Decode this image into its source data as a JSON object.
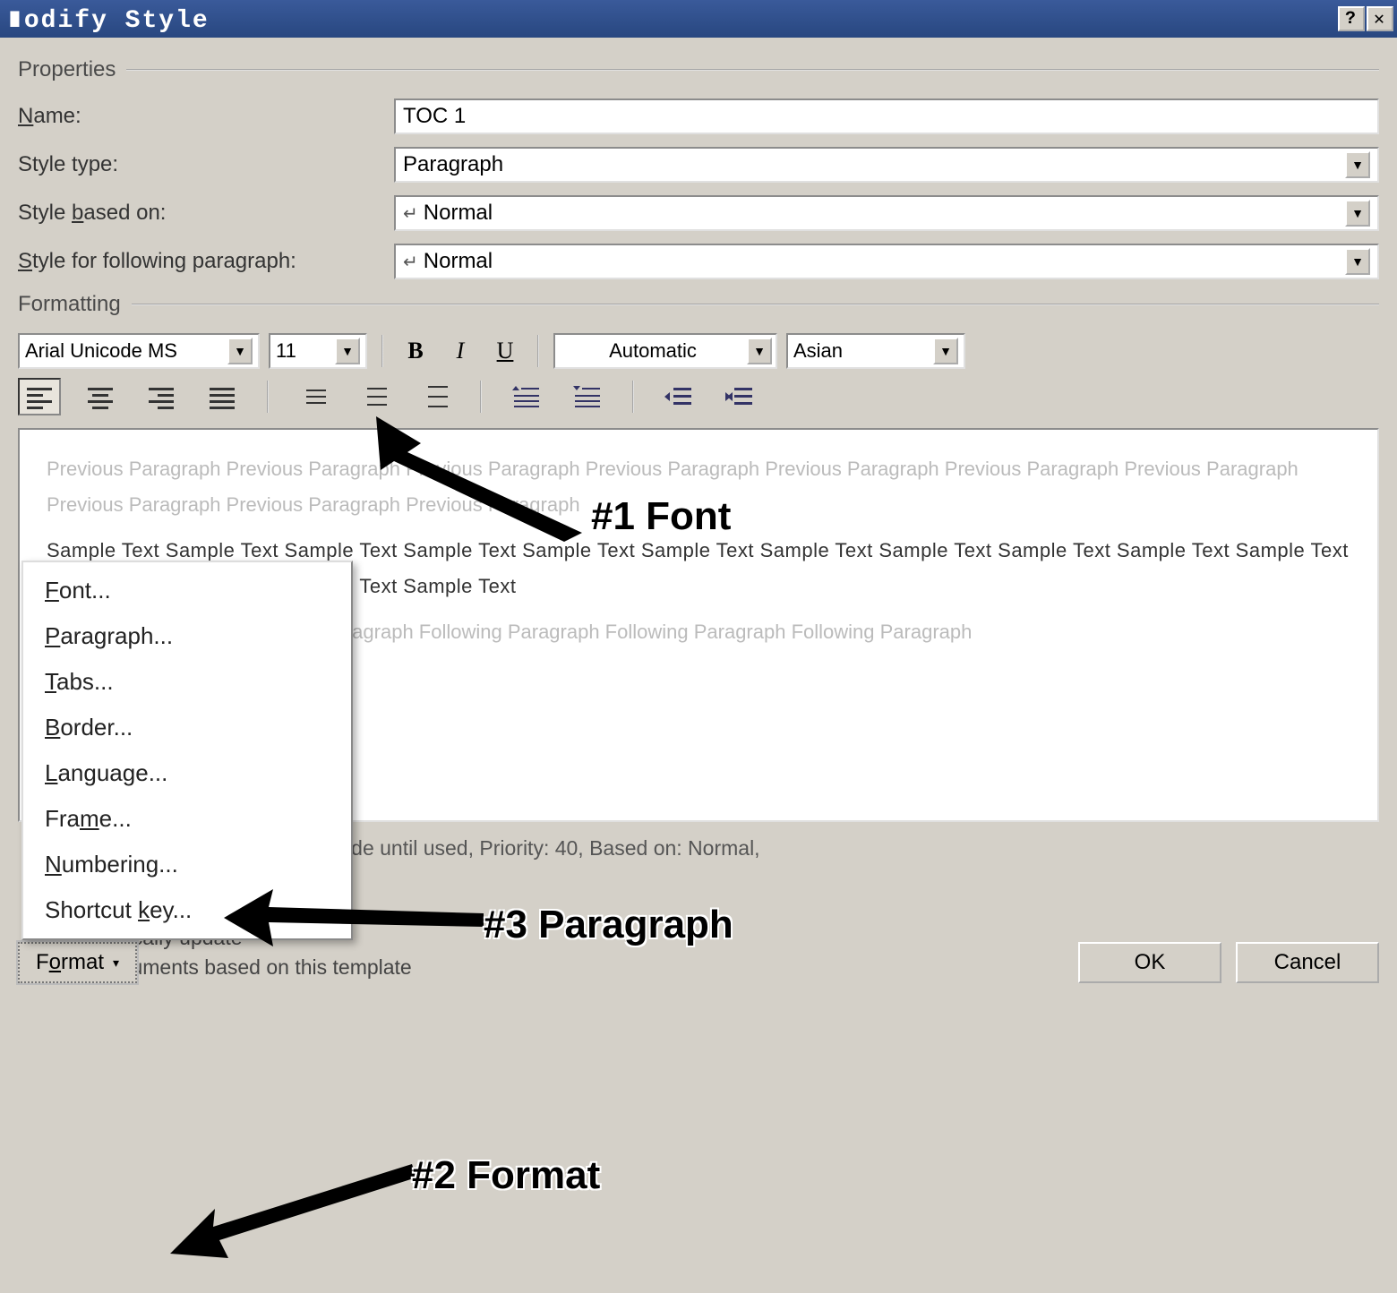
{
  "title": "∎odify Style",
  "titlebar": {
    "help": "?",
    "close": "✕"
  },
  "groups": {
    "properties": "Properties",
    "formatting": "Formatting"
  },
  "props": {
    "name_label": "Name:",
    "name_u": "N",
    "name_value": "TOC 1",
    "type_label": "Style type:",
    "type_value": "Paragraph",
    "based_label_pre": "Style ",
    "based_label_u": "b",
    "based_label_post": "ased on:",
    "based_value": "Normal",
    "follow_label_u": "S",
    "follow_label_post": "tyle for following paragraph:",
    "follow_value": "Normal"
  },
  "fmt": {
    "font": "Arial Unicode MS",
    "size": "11",
    "color": "Automatic",
    "lang": "Asian"
  },
  "preview": {
    "prev": "Previous Paragraph Previous Paragraph Previous Paragraph Previous Paragraph Previous Paragraph Previous Paragraph Previous Paragraph Previous Paragraph Previous Paragraph Previous Paragraph",
    "sample": "Sample Text Sample Text Sample Text Sample Text Sample Text Sample Text Sample Text Sample Text Sample Text Sample Text Sample Text Sample Text Sample Text Sample Text Sample Text",
    "next": "Following Paragraph Following Paragraph Following Paragraph Following Paragraph Following Paragraph"
  },
  "summary": "…IS, Style: Automatically update, Hide until used, Priority: 40, Based on: Normal,",
  "options": {
    "auto_update": "Automatically update",
    "new_docs": "New documents based on this template"
  },
  "menu": {
    "font": "Font...",
    "font_u": "F",
    "paragraph": "Paragraph...",
    "paragraph_u": "P",
    "tabs": "Tabs...",
    "tabs_u": "T",
    "border": "Border...",
    "border_u": "B",
    "language": "Language...",
    "language_u": "L",
    "frame": "Frame...",
    "frame_u": "m",
    "numbering": "Numbering...",
    "numbering_u": "N",
    "shortcut": "Shortcut key...",
    "shortcut_u": "k"
  },
  "buttons": {
    "format": "Format",
    "format_u": "o",
    "ok": "OK",
    "cancel": "Cancel"
  },
  "anno": {
    "a1": "#1 Font",
    "a2": "#2 Format",
    "a3": "#3 Paragraph"
  }
}
